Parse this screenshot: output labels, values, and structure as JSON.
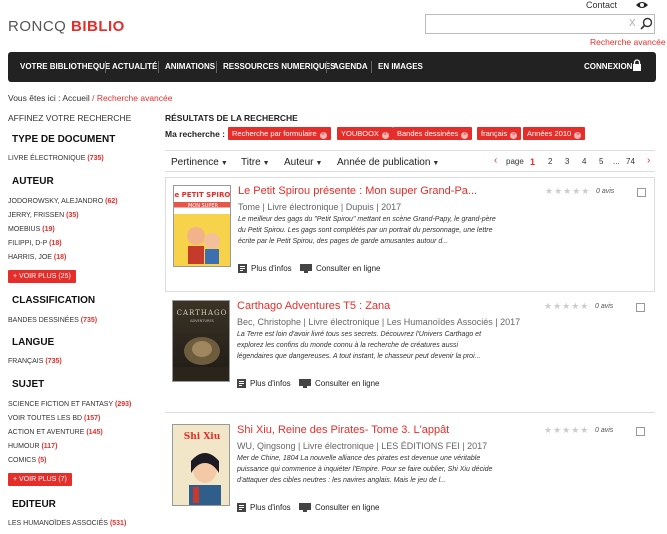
{
  "header": {
    "logo_part1": "RONCQ",
    "logo_part2": "BIBLIO",
    "contact": "Contact",
    "search_placeholder": "",
    "search_clear": "X",
    "advanced_link": "Recherche avancée"
  },
  "nav": {
    "items": [
      "VOTRE BIBLIOTHEQUE",
      "ACTUALITÉ",
      "ANIMATIONS",
      "RESSOURCES NUMERIQUES",
      "AGENDA",
      "EN IMAGES"
    ],
    "login": "CONNEXION"
  },
  "breadcrumb": {
    "prefix": "Vous êtes ici :",
    "home": "Accueil",
    "sep": "/",
    "current": "Recherche avancée"
  },
  "sidebar": {
    "title": "AFFINEZ VOTRE RECHERCHE",
    "facets": [
      {
        "heading": "TYPE DE DOCUMENT",
        "items": [
          {
            "label": "LIVRE ÉLECTRONIQUE",
            "count": "(735)"
          }
        ]
      },
      {
        "heading": "AUTEUR",
        "items": [
          {
            "label": "JODOROWSKY, ALEJANDRO",
            "count": "(62)"
          },
          {
            "label": "JERRY, FRISSEN",
            "count": "(35)"
          },
          {
            "label": "MOEBIUS",
            "count": "(19)"
          },
          {
            "label": "FILIPPI, D-P",
            "count": "(18)"
          },
          {
            "label": "HARRIS, JOE",
            "count": "(18)"
          }
        ],
        "more": "+ VOIR PLUS (25)"
      },
      {
        "heading": "CLASSIFICATION",
        "items": [
          {
            "label": "BANDES DESSINÉES",
            "count": "(735)"
          }
        ]
      },
      {
        "heading": "LANGUE",
        "items": [
          {
            "label": "FRANÇAIS",
            "count": "(735)"
          }
        ]
      },
      {
        "heading": "SUJET",
        "items": [
          {
            "label": "SCIENCE FICTION ET FANTASY",
            "count": "(293)"
          },
          {
            "label": "VOIR TOUTES LES BD",
            "count": "(157)"
          },
          {
            "label": "ACTION ET AVENTURE",
            "count": "(145)"
          },
          {
            "label": "HUMOUR",
            "count": "(117)"
          },
          {
            "label": "COMICS",
            "count": "(5)"
          }
        ],
        "more": "+ VOIR PLUS (7)"
      },
      {
        "heading": "EDITEUR",
        "items": [
          {
            "label": "LES HUMANOÏDES ASSOCIÉS",
            "count": "(531)"
          }
        ]
      }
    ]
  },
  "results": {
    "title": "RÉSULTATS DE LA RECHERCHE",
    "my_search_label": "Ma recherche :",
    "chips": [
      "Recherche par formulaire",
      "YOUBOOX",
      "Bandes dessinées",
      "français",
      "Années 2010"
    ],
    "sort": [
      "Pertinence",
      "Titre",
      "Auteur",
      "Année de publication"
    ],
    "pagination": {
      "label": "page",
      "pages": [
        "1",
        "2",
        "3",
        "4",
        "5",
        "...",
        "74"
      ],
      "active": "1"
    },
    "items": [
      {
        "title": "Le Petit Spirou présente : Mon super Grand-Pa...",
        "meta": "Tome | Livre électronique | Dupuis | 2017",
        "desc": "Le meilleur des gags du \"Petit Spirou\" mettant en scène Grand-Papy, le grand-père du Petit Spirou. Les gags sont complétés par un portrait du personnage, une lettre écrite par le Petit Spirou, des pages de garde amusantes autour d...",
        "avis": "0 avis"
      },
      {
        "title": "Carthago Adventures T5 : Zana",
        "meta": "Bec, Christophe | Livre électronique | Les Humanoïdes Associés | 2017",
        "desc": "La Terre est loin d'avoir livré tous ses secrets. Découvrez l'Univers Carthago et explorez les confins du monde connu à la recherche de créatures aussi légendaires que dangereuses. A tout instant, le chasseur peut devenir la proi...",
        "avis": "0 avis"
      },
      {
        "title": "Shi Xiu, Reine des Pirates- Tome 3. L'appât",
        "meta": "WU, Qingsong | Livre électronique | LES ÉDITIONS FEI | 2017",
        "desc": "Mer de Chine, 1804 La nouvelle alliance des pirates est devenue une véritable puissance qui commence à inquiéter l'Empire. Pour se faire oublier, Shi Xiu décide d'attaquer des cibles neutres : les navires anglais. Mais le jeu de l...",
        "avis": "0 avis"
      }
    ],
    "more_info": "Plus d'infos",
    "consult": "Consulter en ligne"
  },
  "colors": {
    "accent": "#e52e2a",
    "nav_bg": "#222222"
  }
}
